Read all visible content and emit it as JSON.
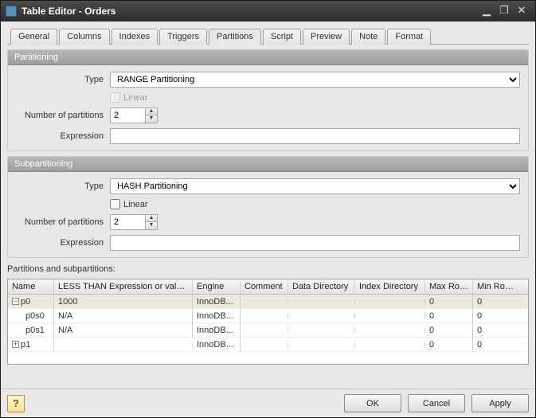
{
  "window": {
    "title": "Table Editor - Orders"
  },
  "tabs": {
    "general": "General",
    "columns": "Columns",
    "indexes": "Indexes",
    "triggers": "Triggers",
    "partitions": "Partitions",
    "script": "Script",
    "preview": "Preview",
    "note": "Note",
    "format": "Format"
  },
  "partitioning": {
    "title": "Partitioning",
    "type_label": "Type",
    "type_value": "RANGE Partitioning",
    "linear_label": "Linear",
    "linear_checked": false,
    "linear_enabled": false,
    "num_label": "Number of partitions",
    "num_value": "2",
    "expr_label": "Expression",
    "expr_value": ""
  },
  "subpartitioning": {
    "title": "Subpartitioning",
    "type_label": "Type",
    "type_value": "HASH Partitioning",
    "linear_label": "Linear",
    "linear_checked": false,
    "linear_enabled": true,
    "num_label": "Number of partitions",
    "num_value": "2",
    "expr_label": "Expression",
    "expr_value": ""
  },
  "grid": {
    "title": "Partitions and subpartitions:",
    "headers": {
      "name": "Name",
      "less_than": "LESS THAN Expression or values list",
      "engine": "Engine",
      "comment": "Comment",
      "data_dir": "Data Directory",
      "index_dir": "Index Directory",
      "max_rows": "Max Rows",
      "min_rows": "Min Rows"
    },
    "rows": [
      {
        "level": 0,
        "expander": "-",
        "name": "p0",
        "less_than": "1000",
        "engine": "InnoDB...",
        "comment": "",
        "data_dir": "",
        "index_dir": "",
        "max_rows": "0",
        "min_rows": "0",
        "selected": true
      },
      {
        "level": 1,
        "expander": "",
        "name": "p0s0",
        "less_than": "N/A",
        "engine": "InnoDB...",
        "comment": "",
        "data_dir": "",
        "index_dir": "",
        "max_rows": "0",
        "min_rows": "0",
        "selected": false
      },
      {
        "level": 1,
        "expander": "",
        "name": "p0s1",
        "less_than": "N/A",
        "engine": "InnoDB...",
        "comment": "",
        "data_dir": "",
        "index_dir": "",
        "max_rows": "0",
        "min_rows": "0",
        "selected": false
      },
      {
        "level": 0,
        "expander": "+",
        "name": "p1",
        "less_than": "",
        "engine": "InnoDB...",
        "comment": "",
        "data_dir": "",
        "index_dir": "",
        "max_rows": "0",
        "min_rows": "0",
        "selected": false
      }
    ]
  },
  "footer": {
    "ok": "OK",
    "cancel": "Cancel",
    "apply": "Apply",
    "help": "?"
  }
}
